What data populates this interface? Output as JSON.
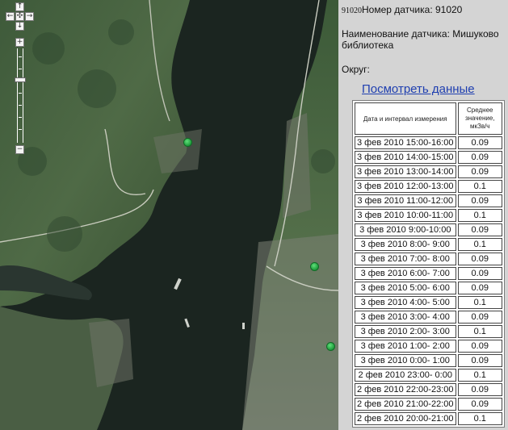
{
  "map": {
    "controls": {
      "pan_up": "↑",
      "pan_left": "←",
      "pan_center": "✣",
      "pan_right": "→",
      "pan_down": "↓",
      "zoom_in": "+",
      "zoom_out": "−"
    },
    "marker_icon": "green-circle-marker"
  },
  "panel": {
    "sensor_id_small": "91020",
    "sensor_number_label": "Номер датчика: 91020",
    "sensor_name_label": "Наименование датчика: Мишуково библиотека",
    "district_label": "Округ:",
    "view_data_link": "Посмотреть данные",
    "table": {
      "headers": [
        "Дата и интервал измерения",
        "Среднее значение, мкЗв/ч"
      ],
      "rows": [
        [
          "3 фев 2010 15:00-16:00",
          "0.09"
        ],
        [
          "3 фев 2010 14:00-15:00",
          "0.09"
        ],
        [
          "3 фев 2010 13:00-14:00",
          "0.09"
        ],
        [
          "3 фев 2010 12:00-13:00",
          "0.1"
        ],
        [
          "3 фев 2010 11:00-12:00",
          "0.09"
        ],
        [
          "3 фев 2010 10:00-11:00",
          "0.1"
        ],
        [
          "3 фев 2010 9:00-10:00",
          "0.09"
        ],
        [
          "3 фев 2010 8:00- 9:00",
          "0.1"
        ],
        [
          "3 фев 2010 7:00- 8:00",
          "0.09"
        ],
        [
          "3 фев 2010 6:00- 7:00",
          "0.09"
        ],
        [
          "3 фев 2010 5:00- 6:00",
          "0.09"
        ],
        [
          "3 фев 2010 4:00- 5:00",
          "0.1"
        ],
        [
          "3 фев 2010 3:00- 4:00",
          "0.09"
        ],
        [
          "3 фев 2010 2:00- 3:00",
          "0.1"
        ],
        [
          "3 фев 2010 1:00- 2:00",
          "0.09"
        ],
        [
          "3 фев 2010 0:00- 1:00",
          "0.09"
        ],
        [
          "2 фев 2010 23:00- 0:00",
          "0.1"
        ],
        [
          "2 фев 2010 22:00-23:00",
          "0.09"
        ],
        [
          "2 фев 2010 21:00-22:00",
          "0.09"
        ],
        [
          "2 фев 2010 20:00-21:00",
          "0.1"
        ]
      ]
    }
  }
}
